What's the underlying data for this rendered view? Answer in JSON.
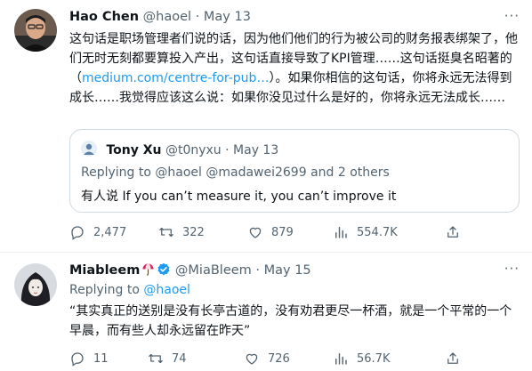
{
  "tweets": [
    {
      "author": {
        "name": "Hao Chen",
        "handle": "@haoel",
        "date": "May 13"
      },
      "more_label": "···",
      "text_before_link": "这句话是职场管理者们说的话，因为他们他们的行为被公司的财务报表绑架了，他们无时无刻都要算投入产出，这句话直接导致了KPI管理……这句话挺臭名昭著的（",
      "link_text": "medium.com/centre-for-pub…",
      "text_after_link": "）。如果你相信的这句话，你将永远无法得到成长……我觉得应该这么说：如果你没见过什么是好的，你将永远无法成长……",
      "quote": {
        "name": "Tony Xu",
        "handle": "@t0nyxu",
        "date": "May 13",
        "replying_to": "Replying to @haoel @madawei2699 and 2 others",
        "text": "有人说 If you can’t measure it, you can’t improve it"
      },
      "stats": {
        "replies": "2,477",
        "retweets": "322",
        "likes": "879",
        "views": "554.7K"
      }
    },
    {
      "author": {
        "name": "Miableem",
        "handle": "@MiaBleem",
        "date": "May 15"
      },
      "more_label": "···",
      "replying_to_prefix": "Replying to ",
      "replying_to_handle": "@haoel",
      "text": "“其实真正的送别是没有长亭古道的，没有劝君更尽一杯酒，就是一个平常的一个早晨，而有些人却永远留在昨天”",
      "stats": {
        "replies": "11",
        "retweets": "74",
        "likes": "726",
        "views": "56.7K"
      }
    }
  ],
  "sep": "·",
  "colors": {
    "accent": "#1d9bf0",
    "muted": "#536471",
    "border": "#cfd9de",
    "verified": "#1d9bf0",
    "retweet_accent": "#536471"
  },
  "icons": [
    "reply-icon",
    "retweet-icon",
    "like-icon",
    "views-icon",
    "share-icon",
    "verified-badge-icon",
    "umbrella-emoji-icon",
    "more-icon"
  ]
}
